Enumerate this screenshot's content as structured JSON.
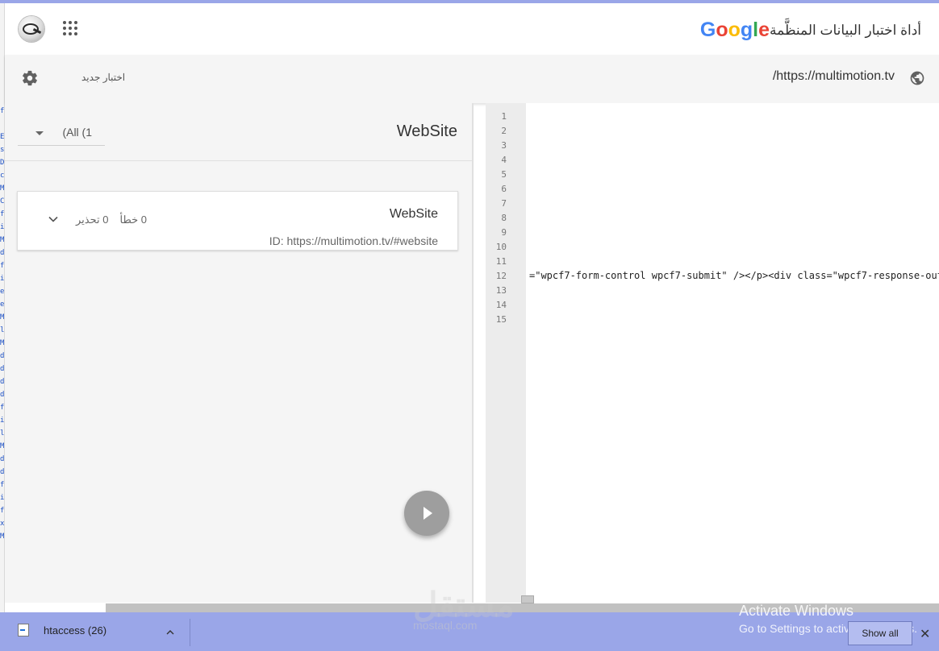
{
  "header": {
    "logo_letters": [
      {
        "ch": "G",
        "color": "#4285F4"
      },
      {
        "ch": "o",
        "color": "#EA4335"
      },
      {
        "ch": "o",
        "color": "#FBBC05"
      },
      {
        "ch": "g",
        "color": "#4285F4"
      },
      {
        "ch": "l",
        "color": "#34A853"
      },
      {
        "ch": "e",
        "color": "#EA4335"
      }
    ],
    "tool_title": "أداة اختبار البيانات المنظَّمة",
    "apps_icon": "apps-grid-icon",
    "avatar_icon": "user-avatar"
  },
  "toolbar": {
    "url": "/https://multimotion.tv",
    "new_test_label": "اختبار جديد",
    "settings_icon": "gear-icon",
    "globe_icon": "globe-icon"
  },
  "results": {
    "type_title": "WebSite",
    "filter_value": "(All (1",
    "item": {
      "title": "WebSite",
      "id_label": "ID: https://multimotion.tv/#website",
      "errors": "0 خطأ",
      "warnings": "0 تحذير"
    },
    "run_icon": "play-icon"
  },
  "editor": {
    "line_numbers": [
      "1",
      "2",
      "3",
      "4",
      "5",
      "6",
      "7",
      "8",
      "9",
      "10",
      "11",
      "12",
      "13",
      "14",
      "15"
    ],
    "code_line_12": "=\"wpcf7-form-control wpcf7-submit\" /></p><div class=\"wpcf7-response-outp"
  },
  "downloads": {
    "file_name": "htaccess (26)",
    "show_all": "Show all",
    "close": "✕"
  },
  "overlay": {
    "activate_title": "Activate Windows",
    "activate_sub": "Go to Settings to activate Windows.",
    "watermark": "مستقل",
    "watermark_sub": "mostaql.com"
  },
  "left_strip_chars": [
    "f",
    "",
    "E",
    "s",
    "D",
    "c",
    "M",
    "C",
    "f",
    "i",
    "M",
    "d",
    "f",
    "i",
    "e",
    "e",
    "M",
    "l",
    "M",
    "d",
    "d",
    "d",
    "d",
    "f",
    "i",
    "l",
    "M",
    "d",
    "d",
    "f",
    "i",
    "f",
    "x",
    "M"
  ]
}
